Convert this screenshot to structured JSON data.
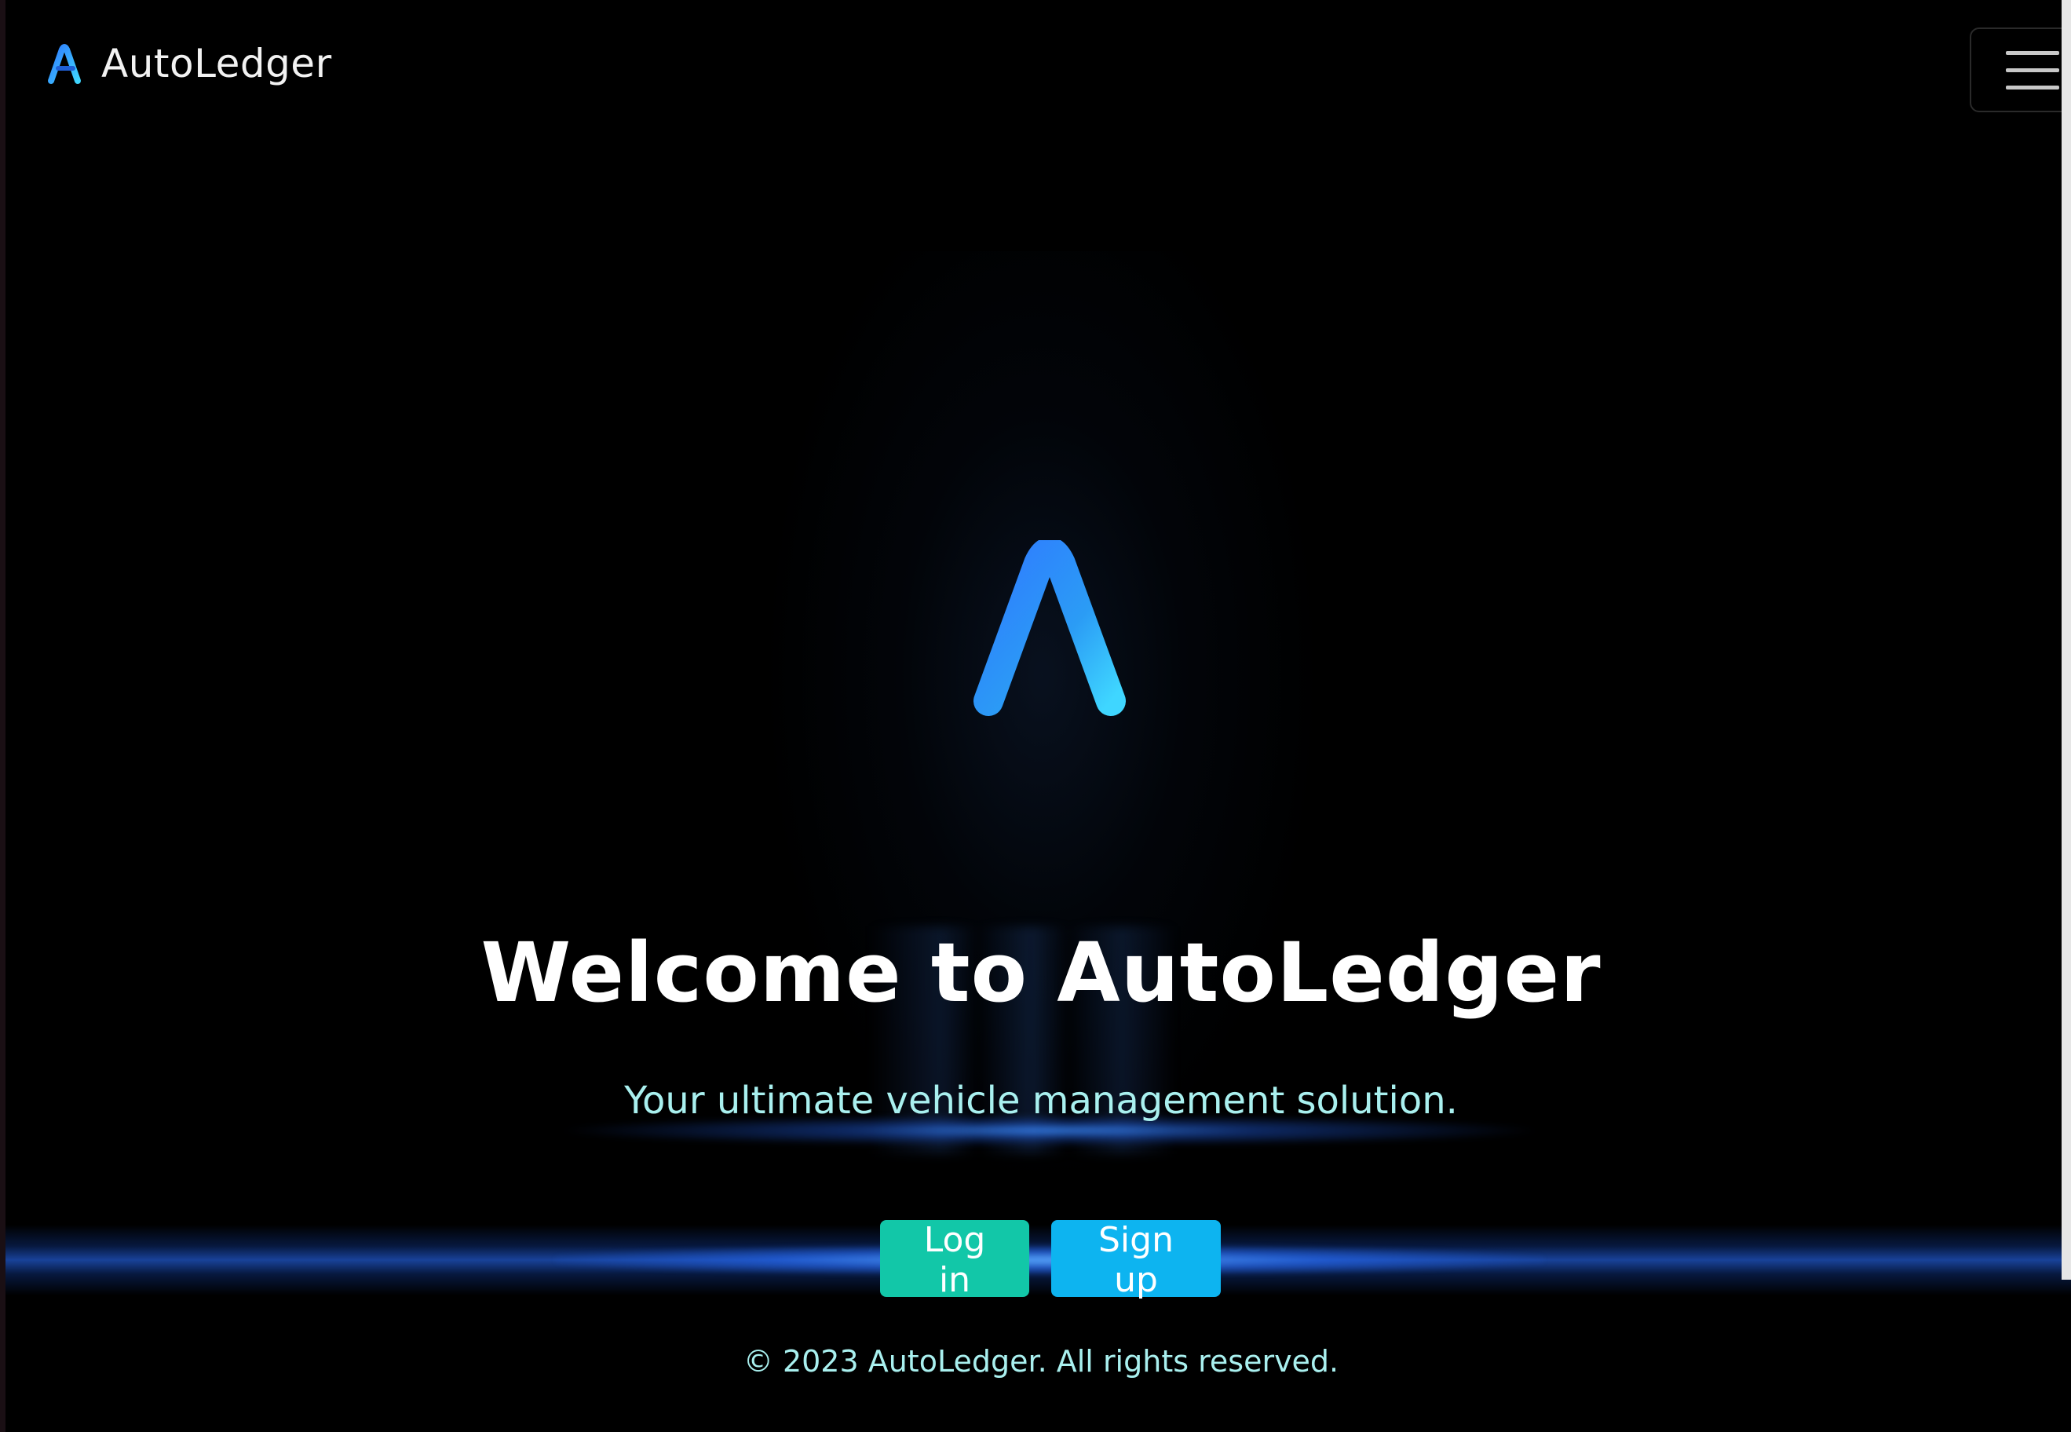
{
  "navbar": {
    "brand_name": "AutoLedger",
    "brand_icon": "autoledger-logo-icon",
    "menu_icon": "hamburger-menu-icon"
  },
  "hero": {
    "logo_icon": "autoledger-logo-icon",
    "title": "Welcome to AutoLedger",
    "subtitle": "Your ultimate vehicle management solution."
  },
  "actions": {
    "login_label": "Log in",
    "signup_label": "Sign up"
  },
  "footer": {
    "copyright": "© 2023 AutoLedger. All rights reserved."
  },
  "colors": {
    "background": "#000000",
    "accent_teal": "#12c7a8",
    "accent_blue": "#0db4f0",
    "subtitle_text": "#a9f0ef",
    "logo_gradient_start": "#2f7bff",
    "logo_gradient_end": "#3fd6ff"
  }
}
